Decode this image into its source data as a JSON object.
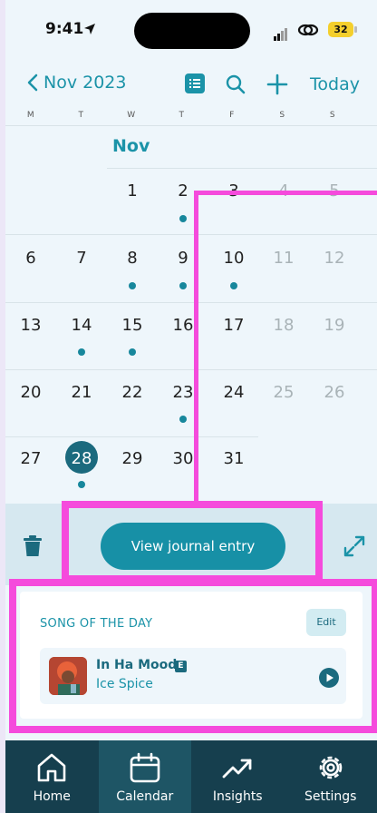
{
  "status_bar": {
    "time": "9:41",
    "battery": "32"
  },
  "header": {
    "back_label": "Nov 2023",
    "today_label": "Today"
  },
  "weekdays": [
    "M",
    "T",
    "W",
    "T",
    "F",
    "S",
    "S"
  ],
  "calendar": {
    "month_label": "Nov",
    "days": [
      "1",
      "2",
      "3",
      "4",
      "5",
      "6",
      "7",
      "8",
      "9",
      "10",
      "11",
      "12",
      "13",
      "14",
      "15",
      "16",
      "17",
      "18",
      "19",
      "20",
      "21",
      "22",
      "23",
      "24",
      "25",
      "26",
      "27",
      "28",
      "29",
      "30",
      "31"
    ],
    "selected_day": "28"
  },
  "actions": {
    "view_entry_label": "View journal entry"
  },
  "song_of_day": {
    "title": "SONG OF THE DAY",
    "edit_label": "Edit",
    "track_name": "In Ha Mood",
    "explicit_badge": "E",
    "artist": "Ice Spice"
  },
  "tabs": [
    {
      "label": "Home",
      "icon": "home-icon"
    },
    {
      "label": "Calendar",
      "icon": "calendar-icon",
      "active": true
    },
    {
      "label": "Insights",
      "icon": "trend-icon"
    },
    {
      "label": "Settings",
      "icon": "gear-icon"
    }
  ],
  "colors": {
    "accent": "#1b93a8",
    "selected": "#1b6a7e",
    "tabbar": "#163f4e",
    "highlight": "#f54bdc"
  }
}
